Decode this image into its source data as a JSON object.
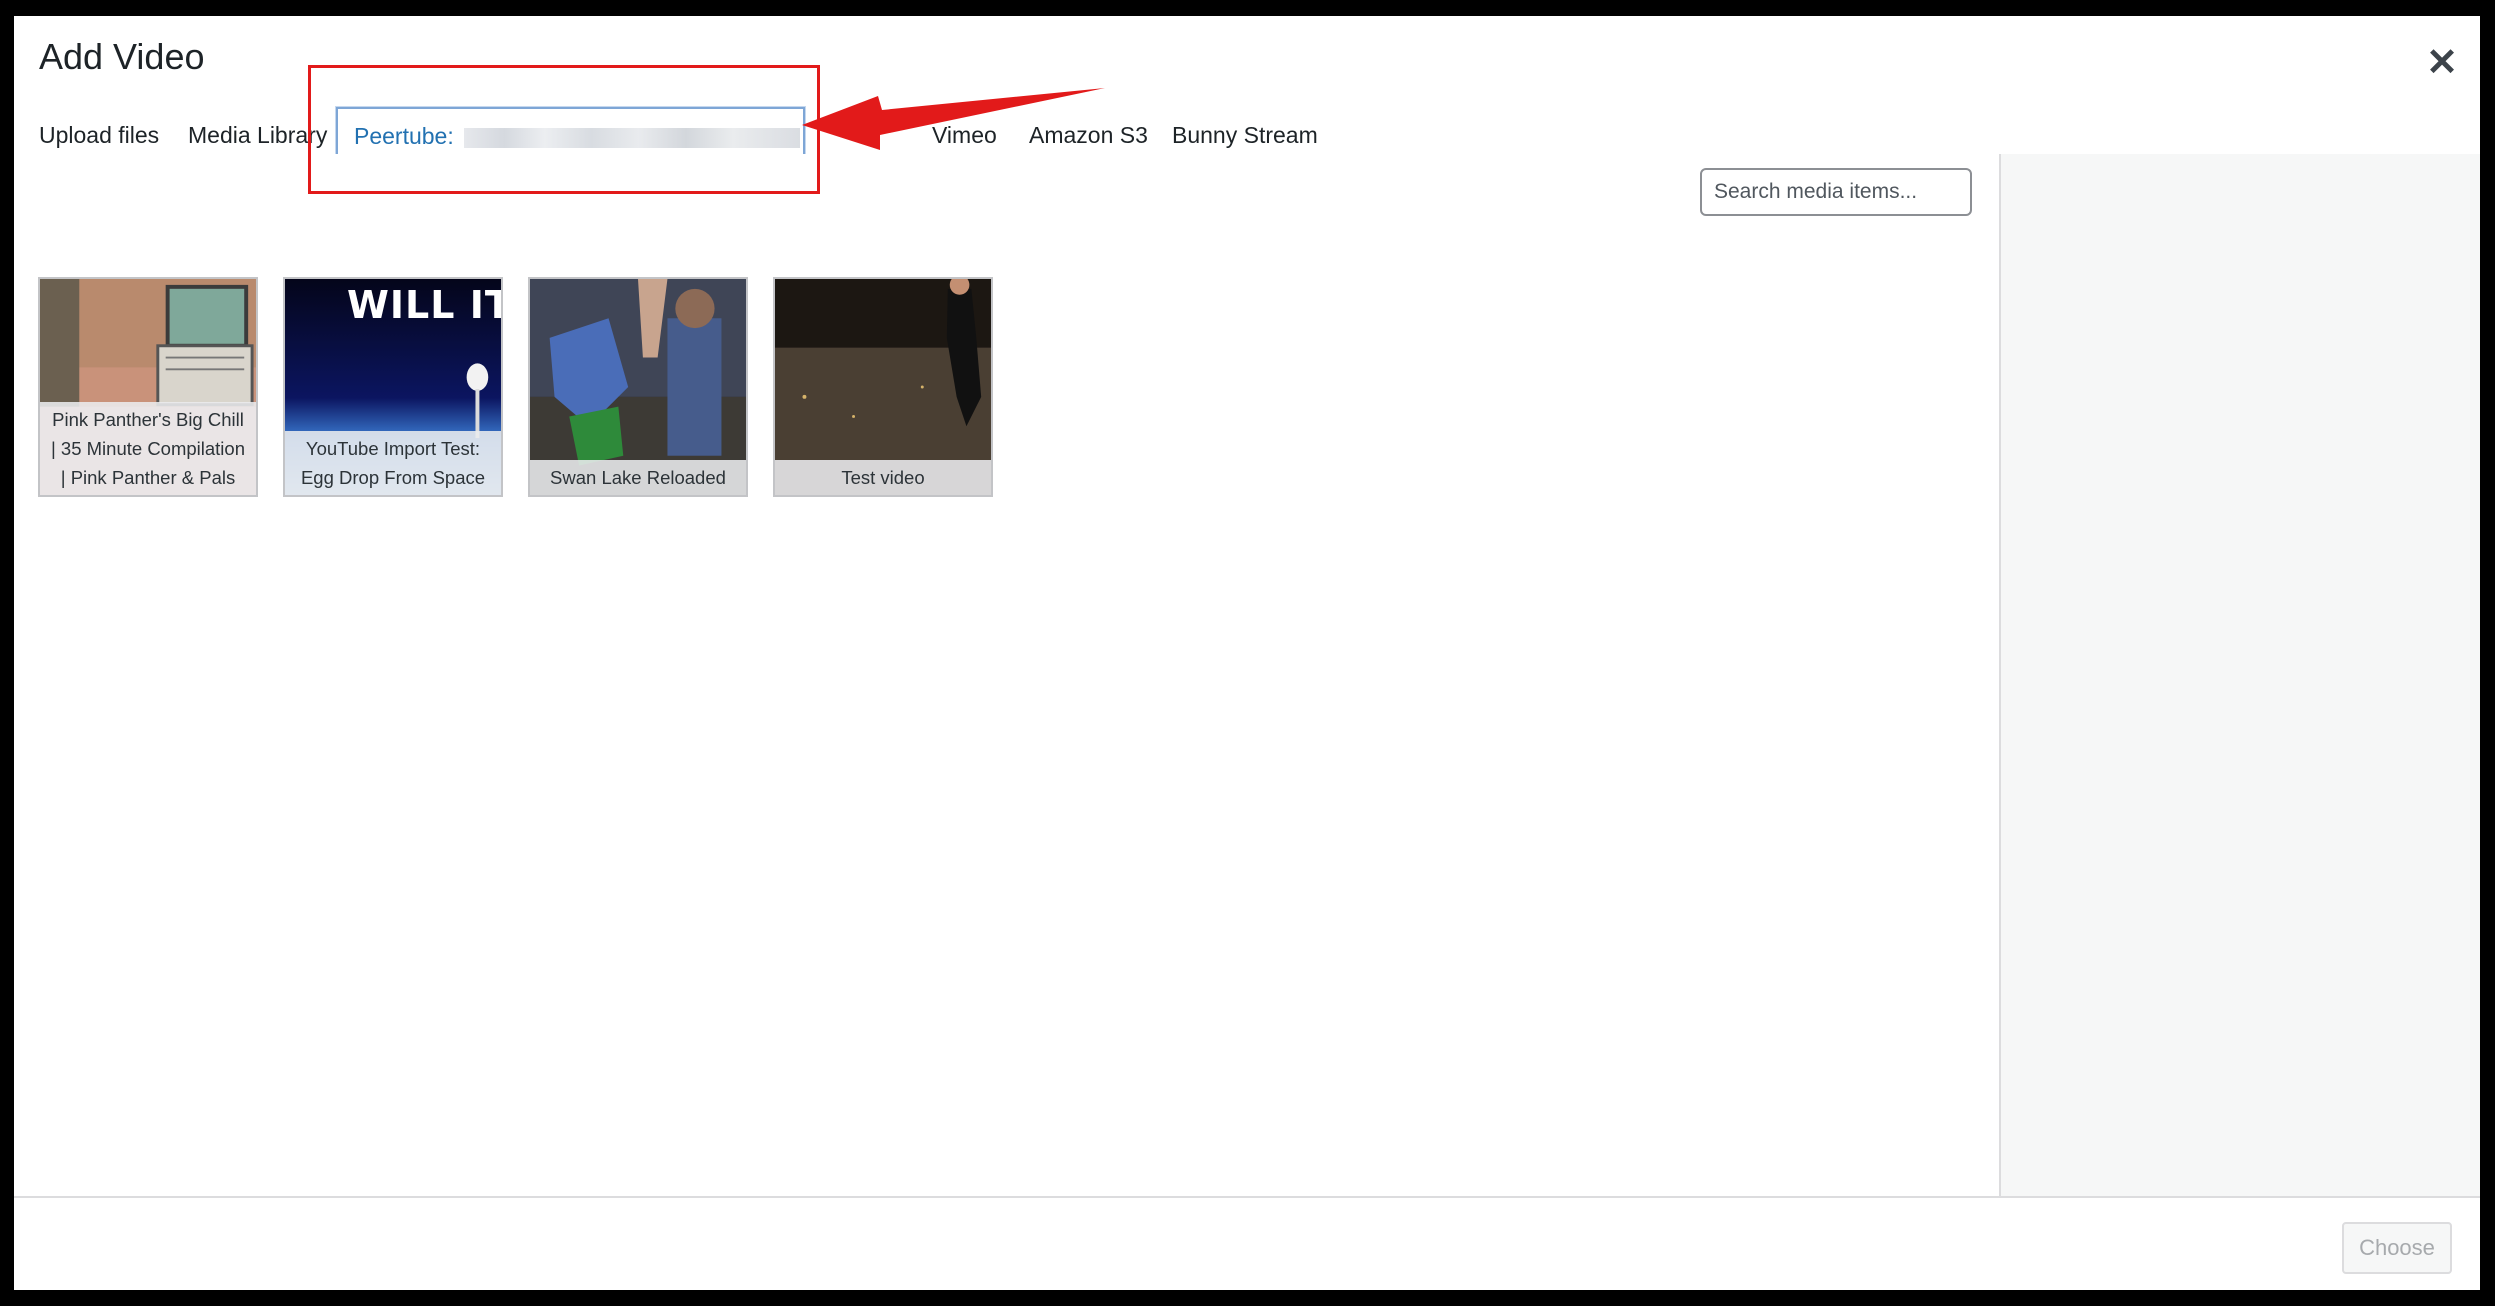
{
  "modal": {
    "title": "Add Video",
    "close_icon": "close-icon"
  },
  "tabs": [
    {
      "label": "Upload files"
    },
    {
      "label": "Media Library"
    },
    {
      "label": "Peertube: "
    },
    {
      "label": "Vimeo"
    },
    {
      "label": "Amazon S3"
    },
    {
      "label": "Bunny Stream"
    }
  ],
  "search": {
    "placeholder": "Search media items..."
  },
  "media_items": [
    {
      "caption": "Pink Panther's Big Chill | 35 Minute Compilation | Pink Panther & Pals"
    },
    {
      "caption": "YouTube Import Test: Egg Drop From Space",
      "thumb_text": "WILL IT B"
    },
    {
      "caption": "Swan Lake Reloaded"
    },
    {
      "caption": "Test video"
    }
  ],
  "footer": {
    "choose_label": "Choose"
  },
  "colors": {
    "accent": "#2271b1",
    "annotation_red": "#e21a1a"
  }
}
